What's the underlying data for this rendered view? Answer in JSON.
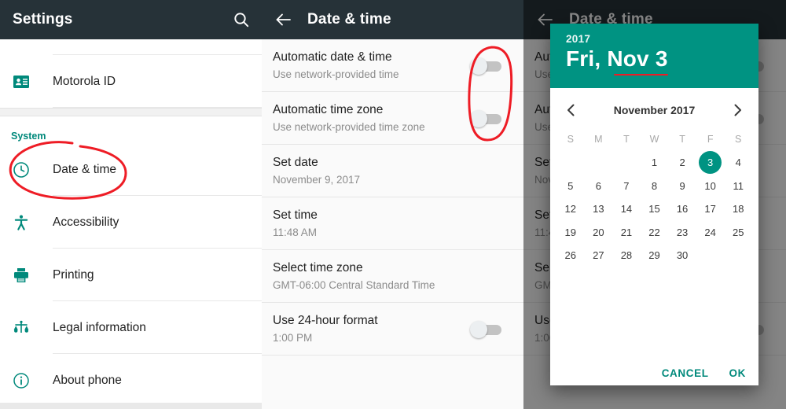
{
  "settings_panel": {
    "appbar": {
      "title": "Settings",
      "search_icon": "search-icon"
    },
    "items": [
      {
        "label": "Motorola ID",
        "icon": "contact-card-icon"
      }
    ],
    "section_header": "System",
    "system_items": [
      {
        "label": "Date & time",
        "icon": "clock-icon"
      },
      {
        "label": "Accessibility",
        "icon": "accessibility-icon"
      },
      {
        "label": "Printing",
        "icon": "printer-icon"
      },
      {
        "label": "Legal information",
        "icon": "scales-icon"
      },
      {
        "label": "About phone",
        "icon": "info-icon"
      }
    ]
  },
  "datetime_panel": {
    "appbar": {
      "title": "Date & time",
      "back_icon": "back-arrow-icon"
    },
    "rows": [
      {
        "title": "Automatic date & time",
        "subtitle": "Use network-provided time",
        "control": "switch",
        "switch_on": false
      },
      {
        "title": "Automatic time zone",
        "subtitle": "Use network-provided time zone",
        "control": "switch",
        "switch_on": false
      },
      {
        "title": "Set date",
        "subtitle": "November 9, 2017",
        "control": "none",
        "annotated_underline": true
      },
      {
        "title": "Set time",
        "subtitle": "11:48 AM",
        "control": "none"
      },
      {
        "title": "Select time zone",
        "subtitle": "GMT-06:00 Central Standard Time",
        "control": "none"
      },
      {
        "title": "Use 24-hour format",
        "subtitle": "1:00 PM",
        "control": "switch",
        "switch_on": false
      }
    ]
  },
  "dialog_panel": {
    "appbar": {
      "title": "Date & time",
      "back_icon": "back-arrow-icon"
    },
    "dialog": {
      "year": "2017",
      "selected_date_label": "Fri, Nov 3",
      "month_label": "November 2017",
      "prev_icon": "chevron-left-icon",
      "next_icon": "chevron-right-icon",
      "weekdays": [
        "S",
        "M",
        "T",
        "W",
        "T",
        "F",
        "S"
      ],
      "leading_blanks": 3,
      "days": [
        1,
        2,
        3,
        4,
        5,
        6,
        7,
        8,
        9,
        10,
        11,
        12,
        13,
        14,
        15,
        16,
        17,
        18,
        19,
        20,
        21,
        22,
        23,
        24,
        25,
        26,
        27,
        28,
        29,
        30
      ],
      "selected_day": 3,
      "cancel_label": "CANCEL",
      "ok_label": "OK"
    }
  },
  "colors": {
    "appbar": "#263238",
    "accent_teal": "#009382",
    "section_header": "#00897b",
    "annotation_red": "#ee1c25",
    "switch_off_track": "#c3c3c3",
    "switch_off_thumb": "#eceff1"
  },
  "annotations": [
    {
      "name": "ellipse-around-date-and-time",
      "shape": "ellipse"
    },
    {
      "name": "ellipse-around-automatic-toggles",
      "shape": "ellipse"
    },
    {
      "name": "underline-under-set-date-value",
      "shape": "line"
    },
    {
      "name": "underline-under-dialog-date",
      "shape": "line"
    }
  ]
}
